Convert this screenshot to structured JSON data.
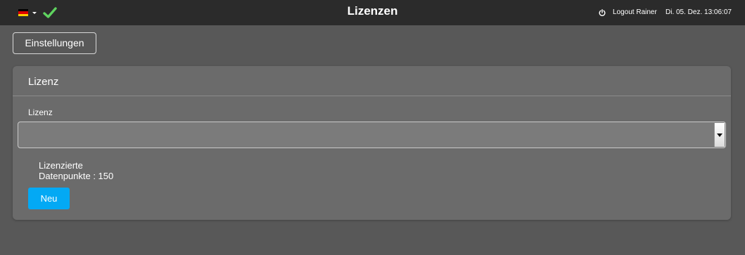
{
  "header": {
    "title": "Lizenzen",
    "language_icon": "flag-de-icon",
    "status_icon": "check-icon",
    "status_color": "#5fd35f",
    "logout_label": "Logout Rainer",
    "datetime": "Di. 05. Dez. 13:06:07"
  },
  "toolbar": {
    "settings_label": "Einstellungen"
  },
  "panel": {
    "title": "Lizenz",
    "field_label": "Lizenz",
    "select_value": "",
    "licensed_line1": "Lizenzierte",
    "licensed_line2": "Datenpunkte : 150",
    "new_label": "Neu",
    "accent_color": "#03a9f4"
  }
}
